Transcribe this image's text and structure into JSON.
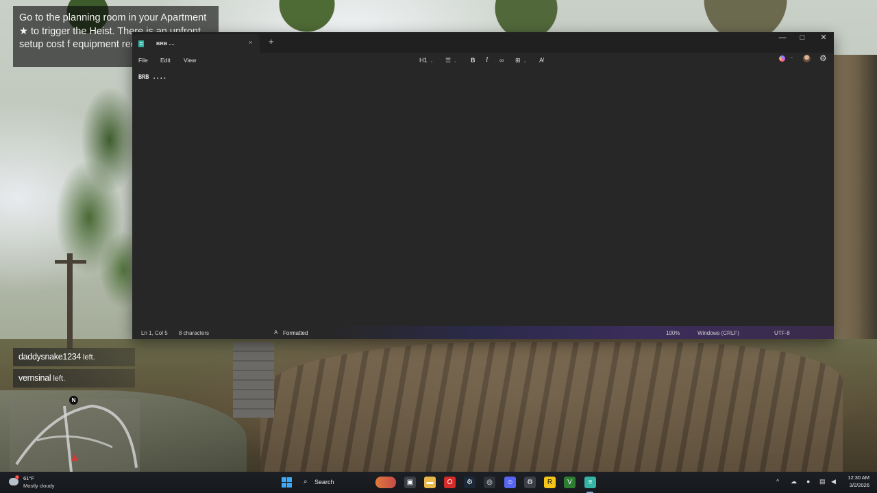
{
  "game_hud": {
    "help_text": "Go to the planning room in your Apartment ★ to trigger the Heist. There is an upfront setup cost f equipment required to c",
    "feed": [
      {
        "name": "daddysnake1234",
        "action": "left."
      },
      {
        "name": "vernsinal",
        "action": "left."
      }
    ],
    "minimap_north": "N"
  },
  "notepad": {
    "tab_title": "BRB ....",
    "tab_close": "×",
    "new_tab": "+",
    "caption": {
      "minimize": "—",
      "maximize": "□",
      "close": "✕"
    },
    "menu": {
      "file": "File",
      "edit": "Edit",
      "view": "View"
    },
    "format": {
      "heading": "H1",
      "list": "☰",
      "bold": "B",
      "italic": "I",
      "link": "∞",
      "table": "⊞",
      "clear": "A̸",
      "caret": "⌄"
    },
    "settings_icon": "⚙",
    "content": "BRB ....",
    "status": {
      "position": "Ln 1, Col 5",
      "characters": "8 characters",
      "format_icon": "A",
      "format": "Formatted",
      "zoom": "100%",
      "line_ending": "Windows (CRLF)",
      "encoding": "UTF-8"
    }
  },
  "taskbar": {
    "weather_temp": "61°F",
    "weather_desc": "Mostly cloudy",
    "weather_badge": "1",
    "search_icon": "⌕",
    "search_label": "Search",
    "apps": [
      {
        "name": "task-view",
        "glyph": "▣",
        "color": "#3b3f46"
      },
      {
        "name": "file-explorer",
        "glyph": "▬",
        "color": "#e8b84a"
      },
      {
        "name": "opera",
        "glyph": "O",
        "color": "#d62b2b"
      },
      {
        "name": "steam",
        "glyph": "⚙",
        "color": "#1b2838"
      },
      {
        "name": "rockstar-social",
        "glyph": "◎",
        "color": "#2d3138"
      },
      {
        "name": "discord",
        "glyph": "☺",
        "color": "#5865f2"
      },
      {
        "name": "settings",
        "glyph": "⚙",
        "color": "#3b3f46"
      },
      {
        "name": "rockstar-games",
        "glyph": "R",
        "color": "#f5c518"
      },
      {
        "name": "vim",
        "glyph": "V",
        "color": "#2e7d32"
      },
      {
        "name": "notepad",
        "glyph": "≡",
        "color": "#35b4a6"
      }
    ],
    "tray": {
      "chevron": "^",
      "onedrive": "☁",
      "mic": "●",
      "network": "▤",
      "volume": "◀"
    },
    "time": "12:30 AM",
    "date": "3/2/2026"
  }
}
